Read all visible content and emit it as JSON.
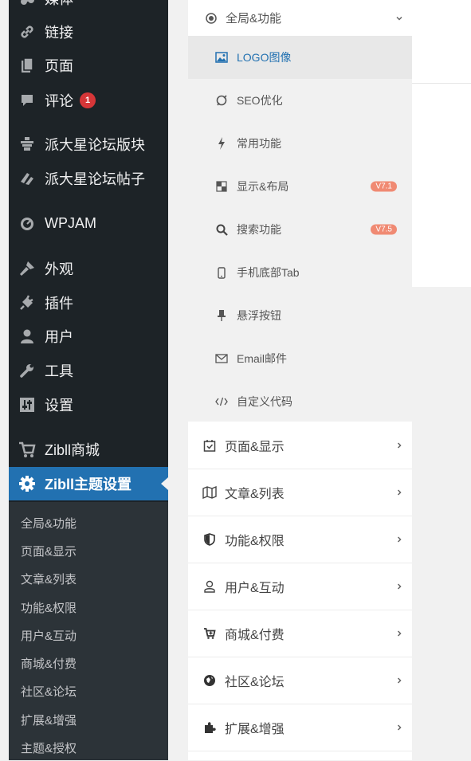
{
  "admin_menu": {
    "items": [
      {
        "label": "媒体",
        "icon": "media-icon"
      },
      {
        "label": "链接",
        "icon": "link-icon"
      },
      {
        "label": "页面",
        "icon": "page-icon"
      },
      {
        "label": "评论",
        "icon": "comment-icon",
        "badge": "1"
      },
      {
        "label": "派大星论坛版块",
        "icon": "forum-board-icon"
      },
      {
        "label": "派大星论坛帖子",
        "icon": "forum-post-icon"
      },
      {
        "label": "WPJAM",
        "icon": "dashboard-gauge-icon"
      },
      {
        "label": "外观",
        "icon": "appearance-brush-icon"
      },
      {
        "label": "插件",
        "icon": "plugin-icon"
      },
      {
        "label": "用户",
        "icon": "user-icon"
      },
      {
        "label": "工具",
        "icon": "wrench-icon"
      },
      {
        "label": "设置",
        "icon": "settings-sliders-icon"
      },
      {
        "label": "Zibll商城",
        "icon": "cart-icon"
      },
      {
        "label": "Zibll主题设置",
        "icon": "gear-icon",
        "active": true
      }
    ],
    "submenu": [
      "全局&功能",
      "页面&显示",
      "文章&列表",
      "功能&权限",
      "用户&互动",
      "商城&付费",
      "社区&论坛",
      "扩展&增强",
      "主题&授权"
    ]
  },
  "options_nav": {
    "expanded_group": {
      "label": "全局&功能",
      "icon": "target-icon"
    },
    "sub_items": [
      {
        "label": "LOGO图像",
        "icon": "image-icon",
        "active": true
      },
      {
        "label": "SEO优化",
        "icon": "seo-icon"
      },
      {
        "label": "常用功能",
        "icon": "bolt-icon"
      },
      {
        "label": "显示&布局",
        "icon": "layout-icon",
        "version": "V7.1"
      },
      {
        "label": "搜索功能",
        "icon": "search-icon",
        "version": "V7.5"
      },
      {
        "label": "手机底部Tab",
        "icon": "mobile-icon"
      },
      {
        "label": "悬浮按钮",
        "icon": "pin-icon"
      },
      {
        "label": "Email邮件",
        "icon": "mail-icon"
      },
      {
        "label": "自定义代码",
        "icon": "code-icon"
      }
    ],
    "groups": [
      {
        "label": "页面&显示",
        "icon": "calendar-check-icon"
      },
      {
        "label": "文章&列表",
        "icon": "map-icon"
      },
      {
        "label": "功能&权限",
        "icon": "shield-icon"
      },
      {
        "label": "用户&互动",
        "icon": "user-outline-icon"
      },
      {
        "label": "商城&付费",
        "icon": "cart-plus-icon"
      },
      {
        "label": "社区&论坛",
        "icon": "globe-icon"
      },
      {
        "label": "扩展&增强",
        "icon": "puzzle-icon"
      }
    ]
  },
  "colors": {
    "accent": "#2271b1",
    "sidebar_bg": "#1d2327",
    "submenu_bg": "#2c3338",
    "badge": "#d63638",
    "version_badge": "#f08a73"
  }
}
